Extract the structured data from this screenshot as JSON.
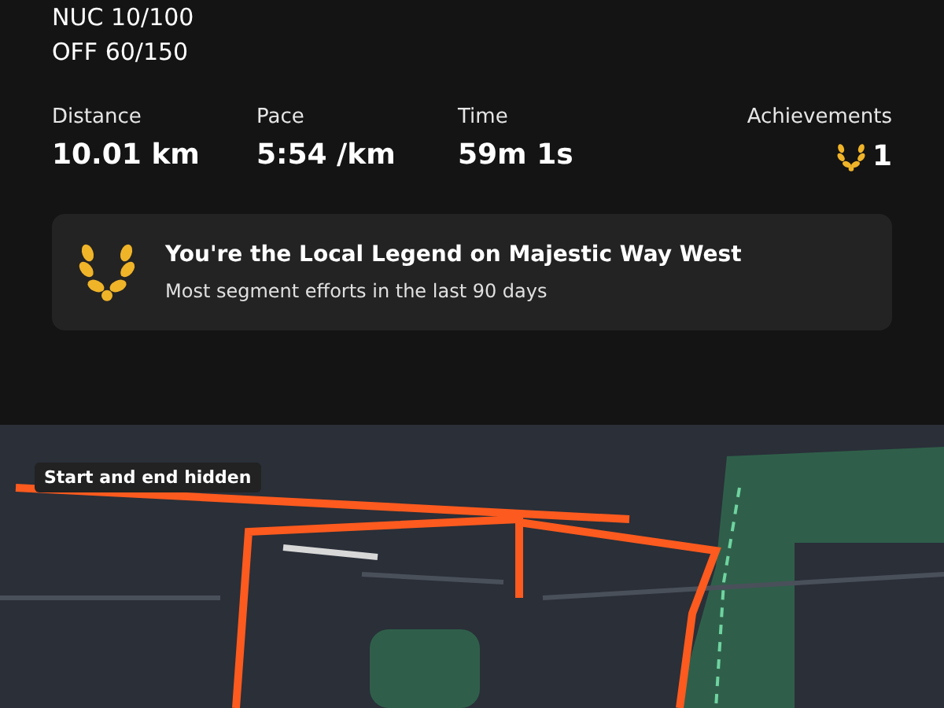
{
  "notes": [
    "NUC 10/100",
    "OFF 60/150"
  ],
  "stats": [
    {
      "label": "Distance",
      "value": "10.01 km",
      "kind": "plain"
    },
    {
      "label": "Pace",
      "value": "5:54 /km",
      "kind": "plain"
    },
    {
      "label": "Time",
      "value": "59m 1s",
      "kind": "plain"
    },
    {
      "label": "Achievements",
      "value": "1",
      "kind": "achievement"
    }
  ],
  "achievement_card": {
    "title": "You're the Local Legend on Majestic Way West",
    "subtitle": "Most segment efforts in the last 90 days"
  },
  "map": {
    "kind": "picture",
    "label": "Start and end hidden"
  }
}
